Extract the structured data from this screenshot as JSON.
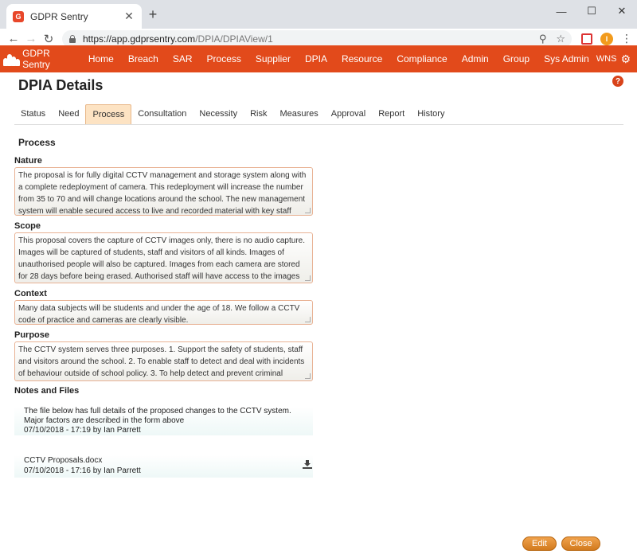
{
  "browser": {
    "tab_title": "GDPR Sentry",
    "tab_favicon_letter": "G",
    "url_host": "https://app.gdprsentry.com",
    "url_path": "/DPIA/DPIAView/1",
    "avatar_letter": "I"
  },
  "app": {
    "brand": "GDPR Sentry",
    "nav": [
      "Home",
      "Breach",
      "SAR",
      "Process",
      "Supplier",
      "DPIA",
      "Resource",
      "Compliance",
      "Admin",
      "Group",
      "Sys Admin"
    ],
    "user": "WNS",
    "accent_color": "#e24a1b"
  },
  "page": {
    "title": "DPIA Details",
    "help": "?",
    "tabs": [
      "Status",
      "Need",
      "Process",
      "Consultation",
      "Necessity",
      "Risk",
      "Measures",
      "Approval",
      "Report",
      "History"
    ],
    "active_tab": "Process",
    "section_title": "Process"
  },
  "fields": {
    "nature": {
      "label": "Nature",
      "value": "The proposal is for fully digital CCTV management and storage system along with a complete redeployment of camera. This redeployment will increase the number from 35 to 70 and will change locations around the school. The new management system will enable secured access to live and recorded material with key staff being able to view video via a mobile app."
    },
    "scope": {
      "label": "Scope",
      "value": "This proposal covers the capture of CCTV images only, there is no audio capture. Images will be captured of students, staff and visitors of all kinds. Images of unauthorised people will also be captured. Images from each camera are stored for 28 days before being erased. Authorised staff will have access to the images over that time"
    },
    "context": {
      "label": "Context",
      "value": "Many data subjects will be students and under the age of 18. We follow a CCTV code of practice and cameras are clearly visible."
    },
    "purpose": {
      "label": "Purpose",
      "value": "The CCTV system serves three purposes. 1. Support the safety of students, staff and visitors around the school. 2. To enable staff to detect and deal with incidents of behaviour outside of school policy. 3. To help detect and prevent criminal activities on school premises"
    }
  },
  "notes": {
    "label": "Notes and Files",
    "items": [
      {
        "text": "The file below has full details of the proposed changes to the CCTV system. Major factors are described in the form above",
        "meta": "07/10/2018 - 17:19 by Ian Parrett"
      },
      {
        "text": "CCTV Proposals.docx",
        "meta": "07/10/2018 - 17:16 by Ian Parrett"
      }
    ]
  },
  "actions": {
    "edit": "Edit",
    "close": "Close"
  }
}
